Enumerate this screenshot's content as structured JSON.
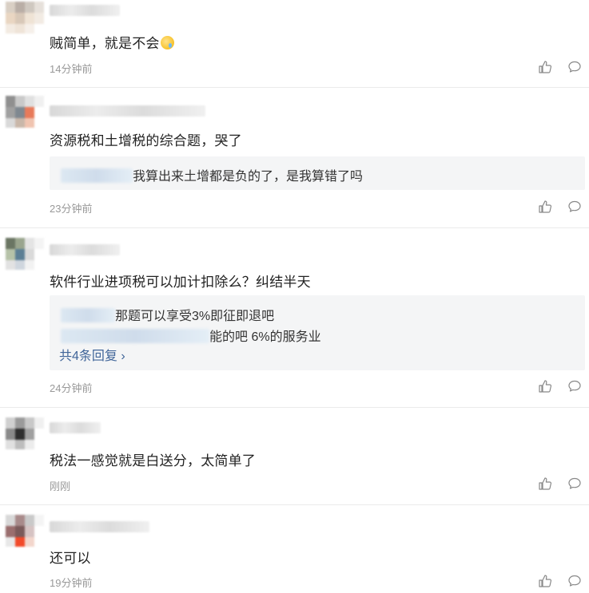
{
  "comments": [
    {
      "text": "贼简单，就是不会",
      "time": "14分钟前",
      "emoji": "sad-face"
    },
    {
      "text": "资源税和土增税的综合题，哭了",
      "time": "23分钟前",
      "replies": [
        {
          "text": "我算出来土增都是负的了，是我算错了吗"
        }
      ]
    },
    {
      "text": "软件行业进项税可以加计扣除么？纠结半天",
      "time": "24分钟前",
      "replies": [
        {
          "text": "那题可以享受3%即征即退吧"
        },
        {
          "text": "能的吧 6%的服务业"
        }
      ],
      "more": "共4条回复"
    },
    {
      "text": "税法一感觉就是白送分，太简单了",
      "time": "刚刚"
    },
    {
      "text": "还可以",
      "time": "19分钟前"
    }
  ],
  "colors": {
    "link": "#406599",
    "meta": "#999999",
    "reply_bg": "#f4f5f6"
  },
  "icons": {
    "like": "thumbs-up-icon",
    "comment": "comment-bubble-icon"
  }
}
